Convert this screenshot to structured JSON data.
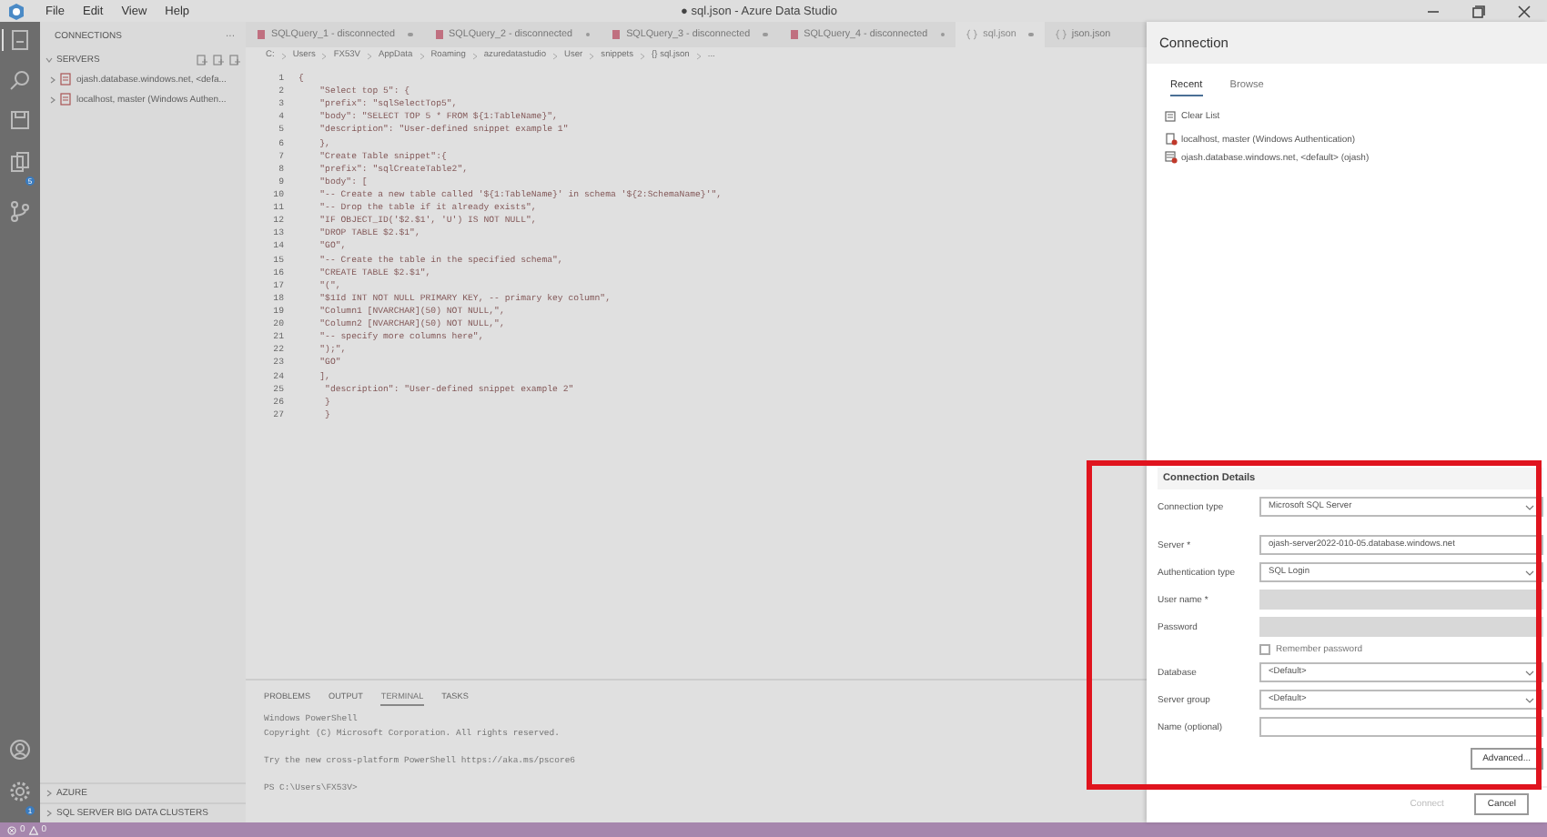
{
  "window": {
    "menu": [
      "File",
      "Edit",
      "View",
      "Help"
    ],
    "title": "● sql.json - Azure Data Studio"
  },
  "activity_bar": {
    "badges": [
      {
        "kind": "extensions",
        "count": "5"
      },
      {
        "kind": "settings",
        "count": "1"
      }
    ]
  },
  "sidebar": {
    "title": "CONNECTIONS",
    "more": "···",
    "section": "SERVERS",
    "servers": [
      {
        "label": "ojash.database.windows.net, <defa...",
        "expanded": false
      },
      {
        "label": "localhost, master (Windows Authen...",
        "expanded": false
      }
    ],
    "bottom_sections": [
      {
        "label": "AZURE",
        "expanded": false
      },
      {
        "label": "SQL SERVER BIG DATA CLUSTERS",
        "expanded": false
      }
    ]
  },
  "tabs": [
    {
      "kind": "query",
      "label": "SQLQuery_1 - disconnected",
      "dirty": true,
      "selected": false
    },
    {
      "kind": "query",
      "label": "SQLQuery_2 - disconnected",
      "dirty": true,
      "selected": false
    },
    {
      "kind": "query",
      "label": "SQLQuery_3 - disconnected",
      "dirty": true,
      "selected": false
    },
    {
      "kind": "query",
      "label": "SQLQuery_4 - disconnected",
      "dirty": true,
      "selected": false
    },
    {
      "kind": "json",
      "label": "sql.json",
      "dirty": true,
      "selected": true
    },
    {
      "kind": "json",
      "label": "json.json",
      "dirty": false,
      "selected": false
    }
  ],
  "breadcrumb": [
    "C:",
    "Users",
    "FX53V",
    "AppData",
    "Roaming",
    "azuredatastudio",
    "User",
    "snippets",
    "{} sql.json",
    "..."
  ],
  "editor": {
    "line_numbers": [
      "1",
      "2",
      "3",
      "4",
      "5",
      "6",
      "7",
      "8",
      "9",
      "10",
      "11",
      "12",
      "13",
      "14",
      "15",
      "16",
      "17",
      "18",
      "19",
      "20",
      "21",
      "22",
      "23",
      "24",
      "25",
      "26",
      "27"
    ],
    "lines": [
      "{",
      "    \"Select top 5\": {",
      "    \"prefix\": \"sqlSelectTop5\",",
      "    \"body\": \"SELECT TOP 5 * FROM ${1:TableName}\",",
      "    \"description\": \"User-defined snippet example 1\"",
      "    },",
      "    \"Create Table snippet\":{",
      "    \"prefix\": \"sqlCreateTable2\",",
      "    \"body\": [",
      "    \"-- Create a new table called '${1:TableName}' in schema '${2:SchemaName}'\",",
      "    \"-- Drop the table if it already exists\",",
      "    \"IF OBJECT_ID('$2.$1', 'U') IS NOT NULL\",",
      "    \"DROP TABLE $2.$1\",",
      "    \"GO\",",
      "    \"-- Create the table in the specified schema\",",
      "    \"CREATE TABLE $2.$1\",",
      "    \"(\",",
      "    \"$1Id INT NOT NULL PRIMARY KEY, -- primary key column\",",
      "    \"Column1 [NVARCHAR](50) NOT NULL,\",",
      "    \"Column2 [NVARCHAR](50) NOT NULL,\",",
      "    \"-- specify more columns here\",",
      "    \");\",",
      "    \"GO\"",
      "    ],",
      "     \"description\": \"User-defined snippet example 2\"",
      "     }",
      "     }"
    ]
  },
  "panel": {
    "tabs": [
      {
        "label": "PROBLEMS",
        "selected": false
      },
      {
        "label": "OUTPUT",
        "selected": false
      },
      {
        "label": "TERMINAL",
        "selected": true
      },
      {
        "label": "TASKS",
        "selected": false
      }
    ],
    "terminal": [
      {
        "text": "Windows PowerShell",
        "space_before": false
      },
      {
        "text": "Copyright (C) Microsoft Corporation. All rights reserved.",
        "space_before": false
      },
      {
        "text": "Try the new cross-platform PowerShell https://aka.ms/pscore6",
        "space_before": true
      },
      {
        "text": "PS C:\\Users\\FX53V>",
        "space_before": true
      }
    ]
  },
  "status_bar": {
    "errors": "0",
    "warnings": "0"
  },
  "connection_dialog": {
    "title": "Connection",
    "tabs": [
      {
        "label": "Recent",
        "selected": true
      },
      {
        "label": "Browse",
        "selected": false
      }
    ],
    "clear_list": "Clear List",
    "recent": [
      {
        "kind": "local",
        "label": "localhost, master (Windows Authentication)"
      },
      {
        "kind": "azure",
        "label": "ojash.database.windows.net, <default> (ojash)"
      }
    ],
    "details_title": "Connection Details",
    "fields": [
      {
        "kind": "dropdown",
        "label": "Connection type",
        "value": "Microsoft SQL Server",
        "disabled": false
      },
      {
        "kind": "text",
        "label": "Server *",
        "value": "ojash-server2022-010-05.database.windows.net",
        "disabled": false
      },
      {
        "kind": "dropdown",
        "label": "Authentication type",
        "value": "SQL Login",
        "disabled": false
      },
      {
        "kind": "text",
        "label": "User name *",
        "disabled": true
      },
      {
        "kind": "text",
        "label": "Password",
        "disabled": true
      },
      {
        "kind": "checkbox",
        "label": "Remember password",
        "checked": false
      },
      {
        "kind": "dropdown",
        "label": "Database",
        "value": "<Default>",
        "disabled": false
      },
      {
        "kind": "dropdown",
        "label": "Server group",
        "value": "<Default>",
        "disabled": false
      },
      {
        "kind": "text",
        "label": "Name (optional)",
        "disabled": false
      }
    ],
    "advanced": "Advanced...",
    "buttons": [
      {
        "label": "Connect",
        "disabled": true
      },
      {
        "label": "Cancel",
        "disabled": false
      }
    ],
    "highlighted": true
  }
}
